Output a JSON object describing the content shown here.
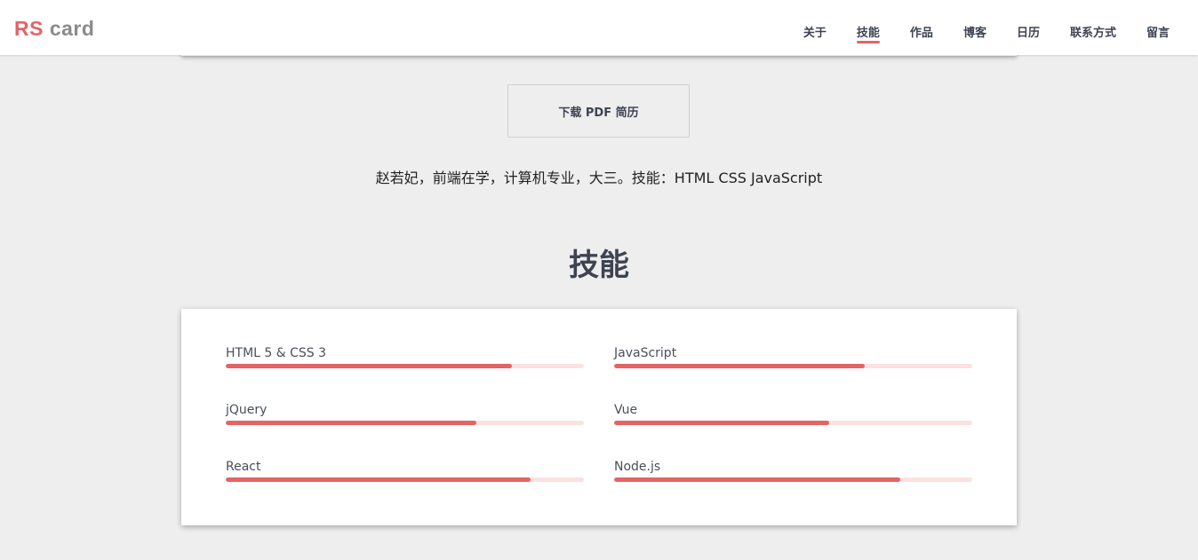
{
  "brand": {
    "logo_part1": "RS",
    "logo_part2": "card",
    "accent_color": "#e56363",
    "logo_grey": "#8b8b8b"
  },
  "nav": {
    "items": [
      {
        "label": "关于",
        "active": false
      },
      {
        "label": "技能",
        "active": true
      },
      {
        "label": "作品",
        "active": false
      },
      {
        "label": "博客",
        "active": false
      },
      {
        "label": "日历",
        "active": false
      },
      {
        "label": "联系方式",
        "active": false
      },
      {
        "label": "留言",
        "active": false
      }
    ]
  },
  "profile": {
    "download_label": "下载 PDF 简历",
    "intro_text": "赵若妃，前端在学，计算机专业，大三。技能：HTML CSS JavaScript"
  },
  "skills_section": {
    "title": "技能",
    "skills": [
      {
        "name": "HTML 5 & CSS 3",
        "level": 80
      },
      {
        "name": "JavaScript",
        "level": 70
      },
      {
        "name": "jQuery",
        "level": 70
      },
      {
        "name": "Vue",
        "level": 60
      },
      {
        "name": "React",
        "level": 85
      },
      {
        "name": "Node.js",
        "level": 80
      }
    ]
  }
}
